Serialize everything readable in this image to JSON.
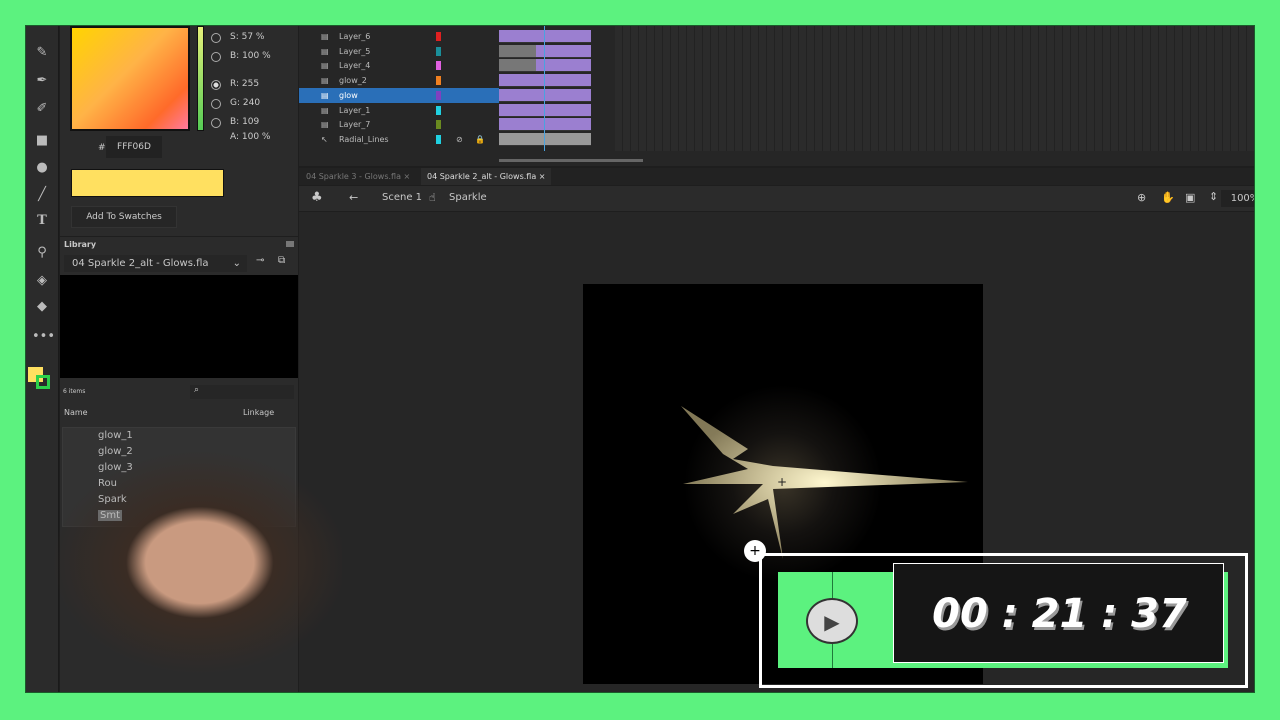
{
  "color_panel": {
    "s": "S: 57 %",
    "b": "B: 100 %",
    "r": "R: 255",
    "g": "G: 240",
    "bl": "B: 109",
    "a": "A: 100 %",
    "hash": "#",
    "hex": "FFF06D",
    "add_swatches": "Add To Swatches",
    "fill_color": "#ffe060"
  },
  "library": {
    "title": "Library",
    "file": "04 Sparkle 2_alt - Glows.fla",
    "count": "6 items",
    "col_name": "Name",
    "col_linkage": "Linkage",
    "items": [
      "glow_1",
      "glow_2",
      "glow_3",
      "Rou",
      "Spark",
      "Smt"
    ]
  },
  "timeline": {
    "layers": [
      {
        "name": "Layer_6",
        "color": "#e02020"
      },
      {
        "name": "Layer_5",
        "color": "#1a8f9a"
      },
      {
        "name": "Layer_4",
        "color": "#e060e0"
      },
      {
        "name": "glow_2",
        "color": "#f08020"
      },
      {
        "name": "glow",
        "color": "#8040c0"
      },
      {
        "name": "Layer_1",
        "color": "#20d0e0"
      },
      {
        "name": "Layer_7",
        "color": "#6a8a20"
      },
      {
        "name": "Radial_Lines",
        "color": "#20d0e0"
      }
    ]
  },
  "tabs": [
    {
      "label": "04 Sparkle 3 - Glows.fla"
    },
    {
      "label": "04 Sparkle 2_alt - Glows.fla"
    }
  ],
  "editbar": {
    "scene": "Scene 1",
    "symbol": "Sparkle",
    "zoom": "100%"
  },
  "timer": {
    "time": "00 : 21 : 37"
  }
}
